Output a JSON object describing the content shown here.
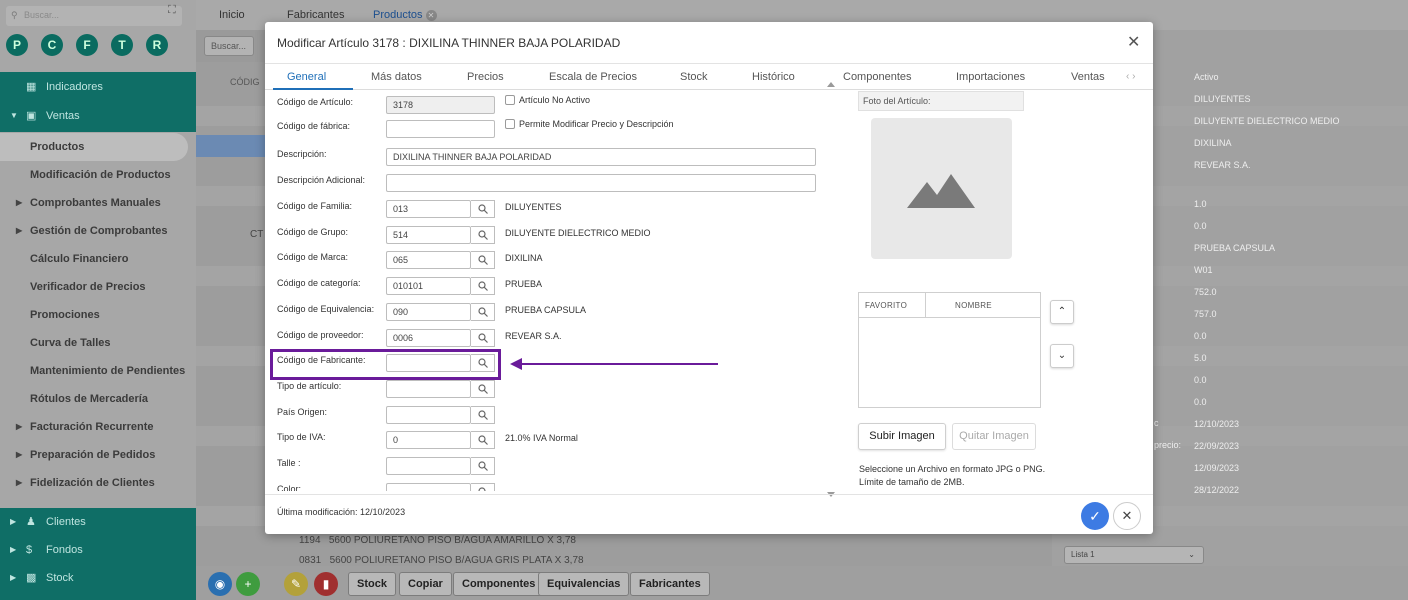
{
  "sidebar": {
    "search_placeholder": "Buscar...",
    "circles": [
      "P",
      "C",
      "F",
      "T",
      "R"
    ],
    "section_indicadores": "Indicadores",
    "section_ventas": "Ventas",
    "items": [
      {
        "label": "Productos",
        "caret": false
      },
      {
        "label": "Modificación de Productos",
        "caret": false
      },
      {
        "label": "Comprobantes Manuales",
        "caret": true
      },
      {
        "label": "Gestión de Comprobantes",
        "caret": true
      },
      {
        "label": "Cálculo Financiero",
        "caret": false
      },
      {
        "label": "Verificador de Precios",
        "caret": false
      },
      {
        "label": "Promociones",
        "caret": false
      },
      {
        "label": "Curva de Talles",
        "caret": false
      },
      {
        "label": "Mantenimiento de Pendientes",
        "caret": false
      },
      {
        "label": "Rótulos de Mercadería",
        "caret": false
      },
      {
        "label": "Facturación Recurrente",
        "caret": true
      },
      {
        "label": "Preparación de Pedidos",
        "caret": true
      },
      {
        "label": "Fidelización de Clientes",
        "caret": true
      }
    ],
    "bottom_sections": [
      "Clientes",
      "Fondos",
      "Stock"
    ]
  },
  "topbar": {
    "tabs": [
      "Inicio",
      "Fabricantes",
      "Productos"
    ]
  },
  "background": {
    "search_placeholder": "Buscar...",
    "col_header": "CÓDIG",
    "ct_label": "CT",
    "rows": [
      {
        "code": "1194",
        "desc": "5600 POLIURETANO PISO B/AGUA AMARILLO X 3,78"
      },
      {
        "code": "0831",
        "desc": "5600 POLIURETANO PISO B/AGUA GRIS PLATA X 3,78"
      }
    ],
    "right_values": [
      "Activo",
      "DILUYENTES",
      "DILUYENTE DIELECTRICO MEDIO",
      "DIXILINA",
      "REVEAR S.A.",
      "1.0",
      "0.0",
      "PRUEBA CAPSULA",
      "W01",
      "752.0",
      "757.0",
      "0.0",
      "5.0",
      "0.0",
      "0.0",
      "12/10/2023",
      "22/09/2023",
      "12/09/2023",
      "28/12/2022"
    ],
    "right_label_c": "c",
    "right_label_precio": "precio:",
    "list_select": "Lista 1"
  },
  "bottombar": {
    "buttons": [
      "Stock",
      "Copiar",
      "Componentes",
      "Equivalencias",
      "Fabricantes"
    ]
  },
  "modal": {
    "title": "Modificar Artículo 3178 : DIXILINA THINNER BAJA POLARIDAD",
    "tabs": [
      "General",
      "Más datos",
      "Precios",
      "Escala de Precios",
      "Stock",
      "Histórico",
      "Componentes",
      "Importaciones",
      "Ventas"
    ],
    "fields": {
      "codigo_articulo": {
        "label": "Código de Artículo:",
        "value": "3178"
      },
      "articulo_no_activo": "Artículo No Activo",
      "codigo_fabrica": {
        "label": "Código de fábrica:",
        "value": ""
      },
      "permite_modificar": "Permite Modificar Precio y Descripción",
      "descripcion": {
        "label": "Descripción:",
        "value": "DIXILINA THINNER BAJA POLARIDAD"
      },
      "descripcion_adicional": {
        "label": "Descripción Adicional:",
        "value": ""
      },
      "familia": {
        "label": "Código de Familia:",
        "value": "013",
        "desc": "DILUYENTES"
      },
      "grupo": {
        "label": "Código de Grupo:",
        "value": "514",
        "desc": "DILUYENTE DIELECTRICO MEDIO"
      },
      "marca": {
        "label": "Código de Marca:",
        "value": "065",
        "desc": "DIXILINA"
      },
      "categoria": {
        "label": "Código de categoría:",
        "value": "010101",
        "desc": "PRUEBA"
      },
      "equivalencia": {
        "label": "Código de Equivalencia:",
        "value": "090",
        "desc": "PRUEBA CAPSULA"
      },
      "proveedor": {
        "label": "Código de proveedor:",
        "value": "0006",
        "desc": "REVEAR S.A."
      },
      "fabricante": {
        "label": "Código de Fabricante:",
        "value": ""
      },
      "tipo_articulo": {
        "label": "Tipo de artículo:",
        "value": ""
      },
      "pais_origen": {
        "label": "País Origen:",
        "value": ""
      },
      "tipo_iva": {
        "label": "Tipo de IVA:",
        "value": "0",
        "desc": "21.0% IVA Normal"
      },
      "talle": {
        "label": "Talle :",
        "value": ""
      },
      "color": {
        "label": "Color:",
        "value": ""
      }
    },
    "photo": {
      "label": "Foto del Artículo:",
      "fav_col": "FAVORITO",
      "name_col": "NOMBRE",
      "upload_btn": "Subir Imagen",
      "remove_btn": "Quitar Imagen",
      "info_line1": "Seleccione un Archivo en formato JPG o PNG.",
      "info_line2": "Límite de tamaño de 2MB."
    },
    "footer": {
      "last_modified": "Última modificación: 12/10/2023"
    }
  },
  "colors": {
    "accent_blue": "#1f6fb8",
    "highlight_purple": "#6a1b9a",
    "ok_blue": "#3d7be3",
    "teal": "#0f6e66"
  }
}
